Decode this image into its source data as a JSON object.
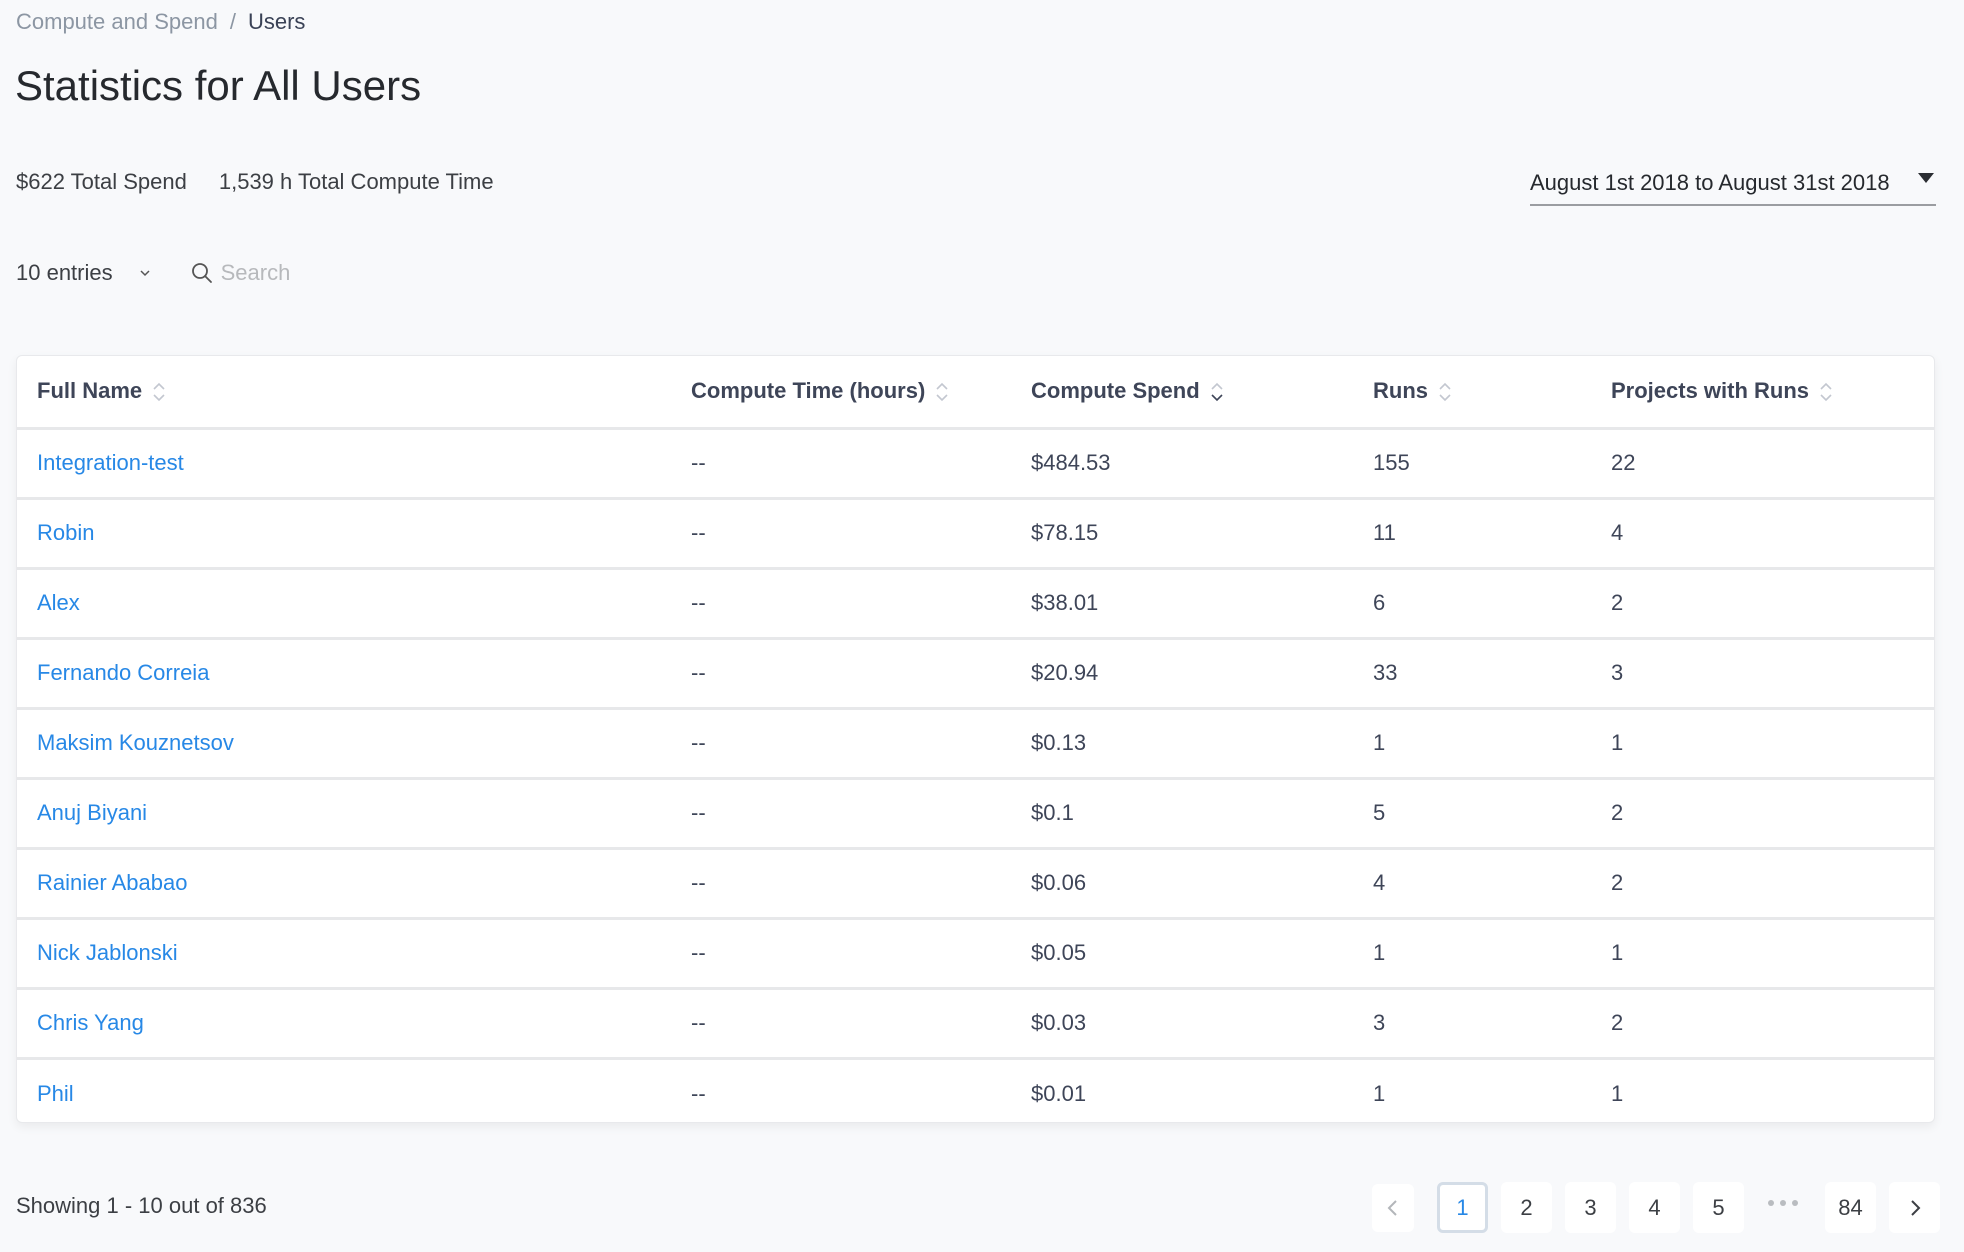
{
  "breadcrumb": {
    "parent": "Compute and Spend",
    "separator": "/",
    "current": "Users"
  },
  "page_title": "Statistics for All Users",
  "stats": {
    "total_spend": "$622 Total Spend",
    "total_compute_time": "1,539 h Total Compute Time"
  },
  "date_range": {
    "selected": "August 1st 2018 to August 31st 2018",
    "icon": "caret-down-icon"
  },
  "controls": {
    "entries_label": "10 entries",
    "search_placeholder": "Search",
    "search_value": ""
  },
  "colors": {
    "link": "#2788e6",
    "background": "#f8f9fb",
    "active_page_border": "#d4dde7"
  },
  "table": {
    "columns": [
      {
        "label": "Full Name",
        "sort": "none"
      },
      {
        "label": "Compute Time (hours)",
        "sort": "none"
      },
      {
        "label": "Compute Spend",
        "sort": "descending"
      },
      {
        "label": "Runs",
        "sort": "none"
      },
      {
        "label": "Projects with Runs",
        "sort": "none"
      }
    ],
    "rows": [
      {
        "name": "Integration-test",
        "compute_time": "--",
        "spend": "$484.53",
        "runs": "155",
        "projects": "22"
      },
      {
        "name": "Robin",
        "compute_time": "--",
        "spend": "$78.15",
        "runs": "11",
        "projects": "4"
      },
      {
        "name": "Alex",
        "compute_time": "--",
        "spend": "$38.01",
        "runs": "6",
        "projects": "2"
      },
      {
        "name": "Fernando Correia",
        "compute_time": "--",
        "spend": "$20.94",
        "runs": "33",
        "projects": "3"
      },
      {
        "name": "Maksim Kouznetsov",
        "compute_time": "--",
        "spend": "$0.13",
        "runs": "1",
        "projects": "1"
      },
      {
        "name": "Anuj Biyani",
        "compute_time": "--",
        "spend": "$0.1",
        "runs": "5",
        "projects": "2"
      },
      {
        "name": "Rainier Ababao",
        "compute_time": "--",
        "spend": "$0.06",
        "runs": "4",
        "projects": "2"
      },
      {
        "name": "Nick Jablonski",
        "compute_time": "--",
        "spend": "$0.05",
        "runs": "1",
        "projects": "1"
      },
      {
        "name": "Chris Yang",
        "compute_time": "--",
        "spend": "$0.03",
        "runs": "3",
        "projects": "2"
      },
      {
        "name": "Phil",
        "compute_time": "--",
        "spend": "$0.01",
        "runs": "1",
        "projects": "1"
      }
    ]
  },
  "footer": {
    "showing": "Showing 1 - 10 out of 836"
  },
  "pagination": {
    "prev_icon": "chevron-left-icon",
    "next_icon": "chevron-right-icon",
    "pages": [
      "1",
      "2",
      "3",
      "4",
      "5"
    ],
    "current_page": "1",
    "ellipsis": "...",
    "last_page": "84"
  }
}
